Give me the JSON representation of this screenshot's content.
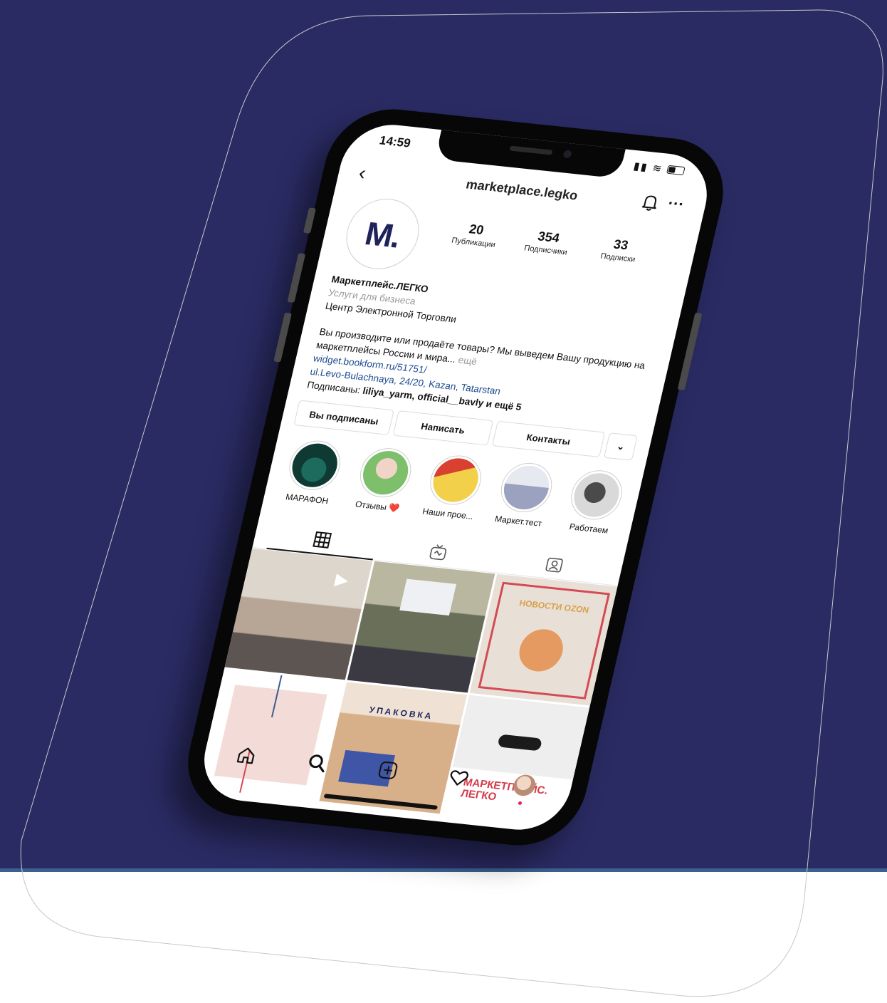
{
  "status": {
    "time": "14:59"
  },
  "header": {
    "username": "marketplace.legko"
  },
  "profile": {
    "avatar_text": "M.",
    "stats": [
      {
        "value": "20",
        "label": "Публикации"
      },
      {
        "value": "354",
        "label": "Подписчики"
      },
      {
        "value": "33",
        "label": "Подписки"
      }
    ],
    "name": "Маркетплейс.ЛЕГКО",
    "category": "Услуги для бизнеса",
    "subtitle": "Центр Электронной Торговли",
    "description": "Вы производите или продаёте товары? Мы выведем Вашу продукцию на маркетплейсы России и мира...",
    "more": "ещё",
    "link": "widget.bookform.ru/51751/",
    "address": "ul.Levo-Bulachnaya, 24/20, Kazan, Tatarstan",
    "followed_by_prefix": "Подписаны:",
    "followed_by_names": "liliya_yarm, official__bavly и ещё 5"
  },
  "buttons": {
    "following": "Вы подписаны",
    "message": "Написать",
    "contacts": "Контакты",
    "more": "⌄"
  },
  "highlights": [
    {
      "label": "МАРАФОН",
      "color": "#0f3a34"
    },
    {
      "label": "Отзывы ❤️",
      "color": "#7dbf6a"
    },
    {
      "label": "Наши прое...",
      "color": "#f2d04a"
    },
    {
      "label": "Маркет.тест",
      "color": "#c9ccd8"
    },
    {
      "label": "Работаем",
      "color": "#8c8c8c"
    }
  ],
  "posts": [
    {
      "color": "#cfc4b8",
      "text": ""
    },
    {
      "color": "#6a6f5a",
      "text": ""
    },
    {
      "color": "#e8e0d6",
      "text": "НОВОСТИ OZON"
    },
    {
      "color": "#f3dcd7",
      "text": ""
    },
    {
      "color": "#d7b08a",
      "text": "УПАКОВКА"
    },
    {
      "color": "#e9e9e9",
      "text": "МАРКЕТПЛЕЙС. ЛЕГКО"
    }
  ]
}
